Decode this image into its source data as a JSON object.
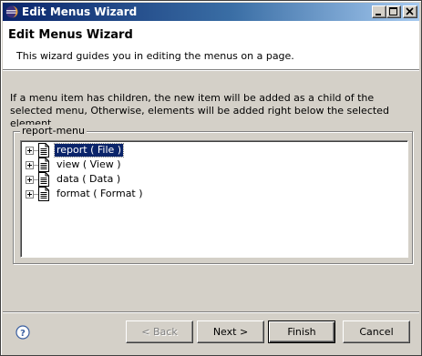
{
  "window": {
    "title": "Edit Menus Wizard",
    "icon": "eclipse-icon",
    "controls": [
      "minimize-icon",
      "maximize-icon",
      "close-icon"
    ]
  },
  "banner": {
    "title": "Edit Menus Wizard",
    "description": "This wizard guides you in editing the menus on a page."
  },
  "instructions": "If a menu item has children, the new item will be added as a child of the selected menu, Otherwise, elements will be added right below the selected element.",
  "group": {
    "label": "report-menu",
    "tree": [
      {
        "label": "report ( File )",
        "selected": true
      },
      {
        "label": "view ( View )",
        "selected": false
      },
      {
        "label": "data ( Data )",
        "selected": false
      },
      {
        "label": "format ( Format )",
        "selected": false
      }
    ]
  },
  "buttons": {
    "back": "< Back",
    "next": "Next >",
    "finish": "Finish",
    "cancel": "Cancel"
  },
  "colors": {
    "titlebar_start": "#0a246a",
    "titlebar_end": "#a6caf0",
    "dialog_bg": "#d4d0c8",
    "selection": "#0a246a"
  }
}
